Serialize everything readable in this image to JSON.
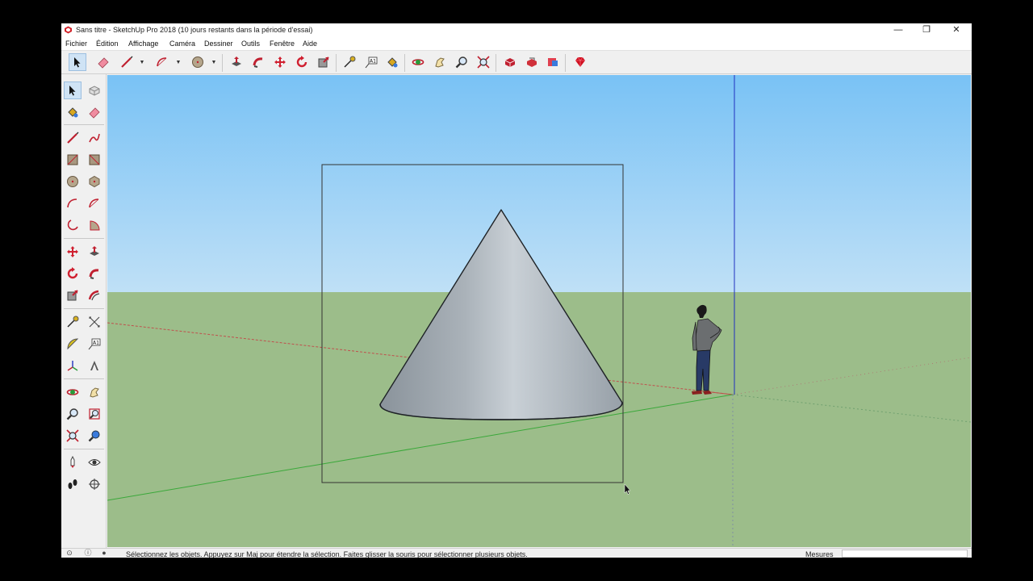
{
  "window": {
    "title": "Sans titre - SketchUp Pro 2018 (10 jours restants dans la période d'essai)",
    "minimize_glyph": "—",
    "maximize_glyph": "❐",
    "close_glyph": "✕"
  },
  "menu": [
    "Fichier",
    "Édition",
    "Affichage",
    "Caméra",
    "Dessiner",
    "Outils",
    "Fenêtre",
    "Aide"
  ],
  "toolbar_icons": [
    "select-icon",
    "eraser-icon",
    "line-icon",
    "arc-icon",
    "circle-icon",
    "push-pull-icon",
    "follow-me-icon",
    "move-icon",
    "rotate-icon",
    "scale-icon",
    "tape-measure-icon",
    "text-icon",
    "paint-bucket-icon",
    "orbit-icon",
    "pan-icon",
    "zoom-icon",
    "zoom-extents-icon",
    "3d-warehouse-icon",
    "extension-warehouse-icon",
    "layout-icon",
    "ruby-icon"
  ],
  "left_toolbar_icons": [
    "select-icon",
    "component-icon",
    "paint-bucket-icon",
    "eraser-icon",
    "line-icon",
    "freehand-icon",
    "rectangle-icon",
    "rotated-rectangle-icon",
    "circle-icon",
    "polygon-icon",
    "arc-icon",
    "two-point-arc-icon",
    "three-point-arc-icon",
    "pie-icon",
    "move-icon",
    "push-pull-icon",
    "rotate-icon",
    "follow-me-icon",
    "scale-icon",
    "offset-icon",
    "tape-measure-icon",
    "dimension-icon",
    "protractor-icon",
    "text-icon",
    "axes-icon",
    "3d-text-icon",
    "orbit-icon",
    "pan-icon",
    "zoom-icon",
    "zoom-window-icon",
    "zoom-extents-icon",
    "previous-view-icon",
    "position-camera-icon",
    "look-around-icon",
    "walk-icon",
    "section-plane-icon"
  ],
  "status": {
    "hint": "Sélectionnez les objets. Appuyez sur Maj pour étendre la sélection. Faites glisser la souris pour sélectionner plusieurs objets.",
    "measure_label": "Mesures",
    "measure_value": ""
  },
  "colors": {
    "sky_top": "#79c2f5",
    "sky_horizon": "#bfe0f6",
    "ground": "#9cbd8a",
    "red_axis": "#c0504d",
    "green_axis": "#3aa83a",
    "blue_axis": "#2030c0",
    "cone_light": "#c9d0d6",
    "cone_dark": "#8a939b"
  }
}
